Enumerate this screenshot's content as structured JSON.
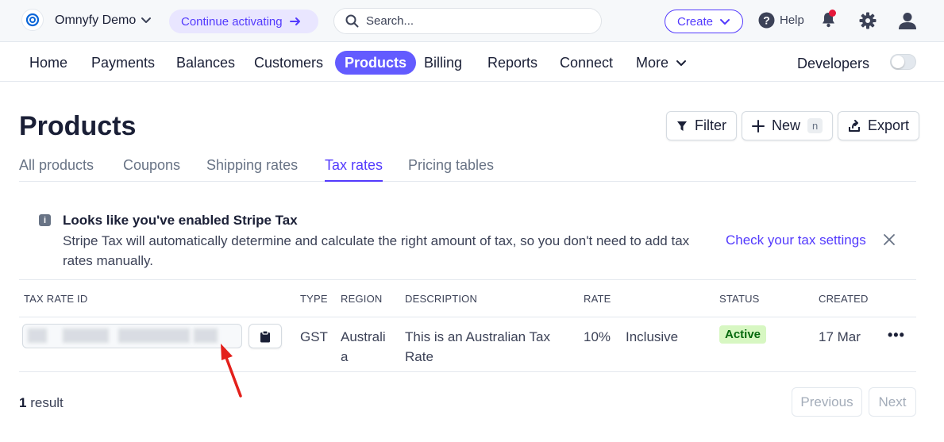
{
  "topbar": {
    "account_name": "Omnyfy Demo",
    "activate_label": "Continue activating",
    "search_placeholder": "Search...",
    "create_label": "Create",
    "help_label": "Help"
  },
  "nav": {
    "items": [
      "Home",
      "Payments",
      "Balances",
      "Customers",
      "Products",
      "Billing",
      "Reports",
      "Connect",
      "More"
    ],
    "active": "Products",
    "developers_label": "Developers",
    "test_mode_on": false
  },
  "page": {
    "title": "Products",
    "filter_label": "Filter",
    "new_label": "New",
    "new_shortcut": "n",
    "export_label": "Export"
  },
  "tabs": {
    "items": [
      "All products",
      "Coupons",
      "Shipping rates",
      "Tax rates",
      "Pricing tables"
    ],
    "active": "Tax rates"
  },
  "banner": {
    "title": "Looks like you've enabled Stripe Tax",
    "body": "Stripe Tax will automatically determine and calculate the right amount of tax, so you don't need to add tax rates manually.",
    "link": "Check your tax settings"
  },
  "table": {
    "headers": [
      "TAX RATE ID",
      "TYPE",
      "REGION",
      "DESCRIPTION",
      "RATE",
      "STATUS",
      "CREATED"
    ],
    "rows": [
      {
        "type": "GST",
        "region": "Australia",
        "description": "This is an Australian Tax Rate",
        "rate": "10%",
        "inclusive": "Inclusive",
        "status": "Active",
        "created": "17 Mar"
      }
    ]
  },
  "footer": {
    "result_count": "1",
    "result_label": "result",
    "previous_label": "Previous",
    "next_label": "Next"
  },
  "colors": {
    "accent": "#635bff",
    "accent_text": "#533afd",
    "status_active_bg": "#d7f7c2",
    "status_active_text": "#05690d",
    "annotation_arrow": "#e3201b"
  }
}
